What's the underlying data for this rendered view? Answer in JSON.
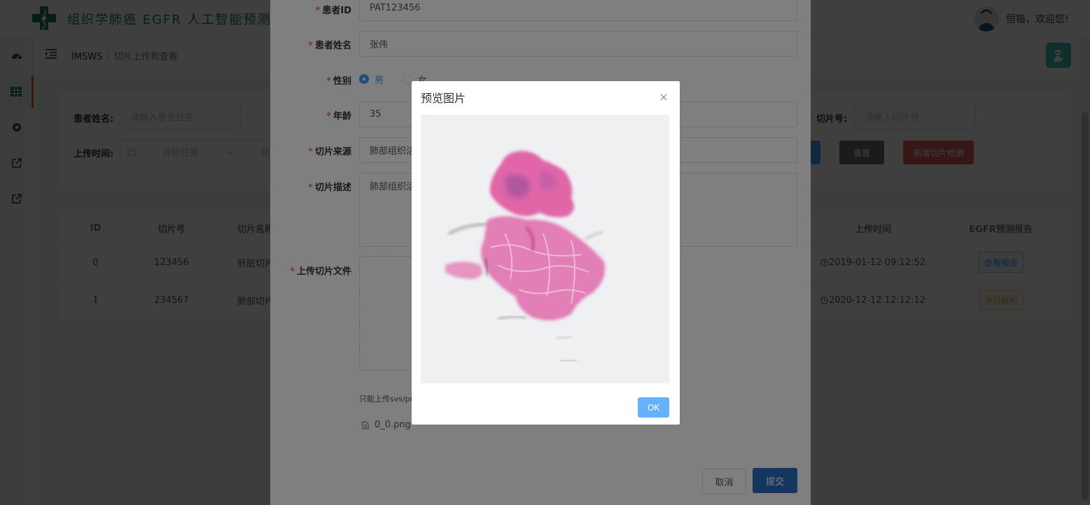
{
  "header": {
    "title": "组织学肺癌 EGFR 人工智能预测系统",
    "welcome": "恒锴，欢迎您!"
  },
  "sidebar": {
    "items": [
      {
        "icon": "dashboard-icon"
      },
      {
        "icon": "grid-icon",
        "active": true
      },
      {
        "icon": "circle-icon"
      },
      {
        "icon": "external-link-icon"
      },
      {
        "icon": "external-link-icon"
      }
    ]
  },
  "breadcrumb": {
    "root": "IMSWS",
    "separator": "/",
    "current": "切片上传和查看"
  },
  "search": {
    "patient_name_label": "患者姓名:",
    "patient_name_placeholder": "请输入患者姓名",
    "upload_time_label": "上传时间:",
    "start_date_placeholder": "开始日期",
    "date_separator": "-",
    "end_date_partial": "结",
    "slide_no_label": "切片号:",
    "slide_no_placeholder": "请输入切片号",
    "reset_button": "重置",
    "add_button": "新增切片检测"
  },
  "table": {
    "headers": {
      "id": "ID",
      "slide_no": "切片号",
      "slide_name": "切片名称",
      "upload_time": "上传时间",
      "report": "EGFR预测报告"
    },
    "rows": [
      {
        "id": "0",
        "slide_no": "123456",
        "slide_name": "肝脏切片",
        "upload_time": "2019-01-12 09:12:52",
        "action": "查看报告"
      },
      {
        "id": "1",
        "slide_no": "234567",
        "slide_name": "肺部切片",
        "upload_time": "2020-12-12 12:12:12",
        "action": "进行解析"
      }
    ]
  },
  "form": {
    "patient_id_label": "患者ID",
    "patient_id_value": "PAT123456",
    "patient_name_label": "患者姓名",
    "patient_name_value": "张伟",
    "gender_label": "性别",
    "gender_male": "男",
    "gender_female": "女",
    "gender_selected": "男",
    "age_label": "年龄",
    "age_value": "35",
    "source_label": "切片来源",
    "source_value_visible": "肺部组织活",
    "description_label": "切片描述",
    "description_value_visible": "肺部组织活",
    "upload_label": "上传切片文件",
    "upload_tip_visible": "只能上传svs/pn",
    "file_name": "0_0.png",
    "cancel_button": "取消",
    "submit_button": "提交",
    "required_mark": "*"
  },
  "preview": {
    "title": "预览图片",
    "close_label": "×",
    "ok_button": "OK",
    "image_icon": "histology-slide-image"
  },
  "colors": {
    "brand_green": "#1c7a63",
    "primary": "#409eff",
    "primary_dark": "#2a6dbf",
    "danger": "#e05b5b",
    "reset_gray": "#6b6e73",
    "warning": "#e6a23c",
    "tissue_pink": "#e066a8"
  }
}
